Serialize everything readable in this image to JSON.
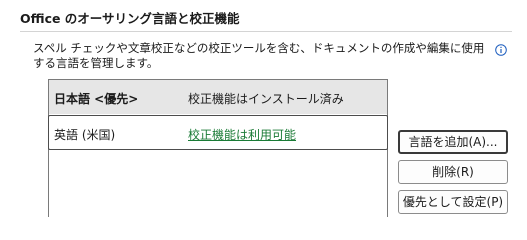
{
  "section": {
    "title": "Office のオーサリング言語と校正機能"
  },
  "description": "スペル チェックや文章校正などの校正ツールを含む、ドキュメントの作成や編集に使用する言語を管理します。",
  "languages": [
    {
      "name": "日本語 <優先>",
      "status": "校正機能はインストール済み",
      "status_is_link": false
    },
    {
      "name": "英語 (米国)",
      "status": "校正機能は利用可能",
      "status_is_link": true
    }
  ],
  "buttons": {
    "add_label": "言語を追加(A)...",
    "remove_label": "削除(R)",
    "set_default_label": "優先として設定(P)"
  },
  "colors": {
    "link": "#1a7b36",
    "primary_row_bg": "#e6e6e6",
    "info_icon": "#1f5fbf"
  },
  "icons": {
    "info": "info-icon"
  }
}
